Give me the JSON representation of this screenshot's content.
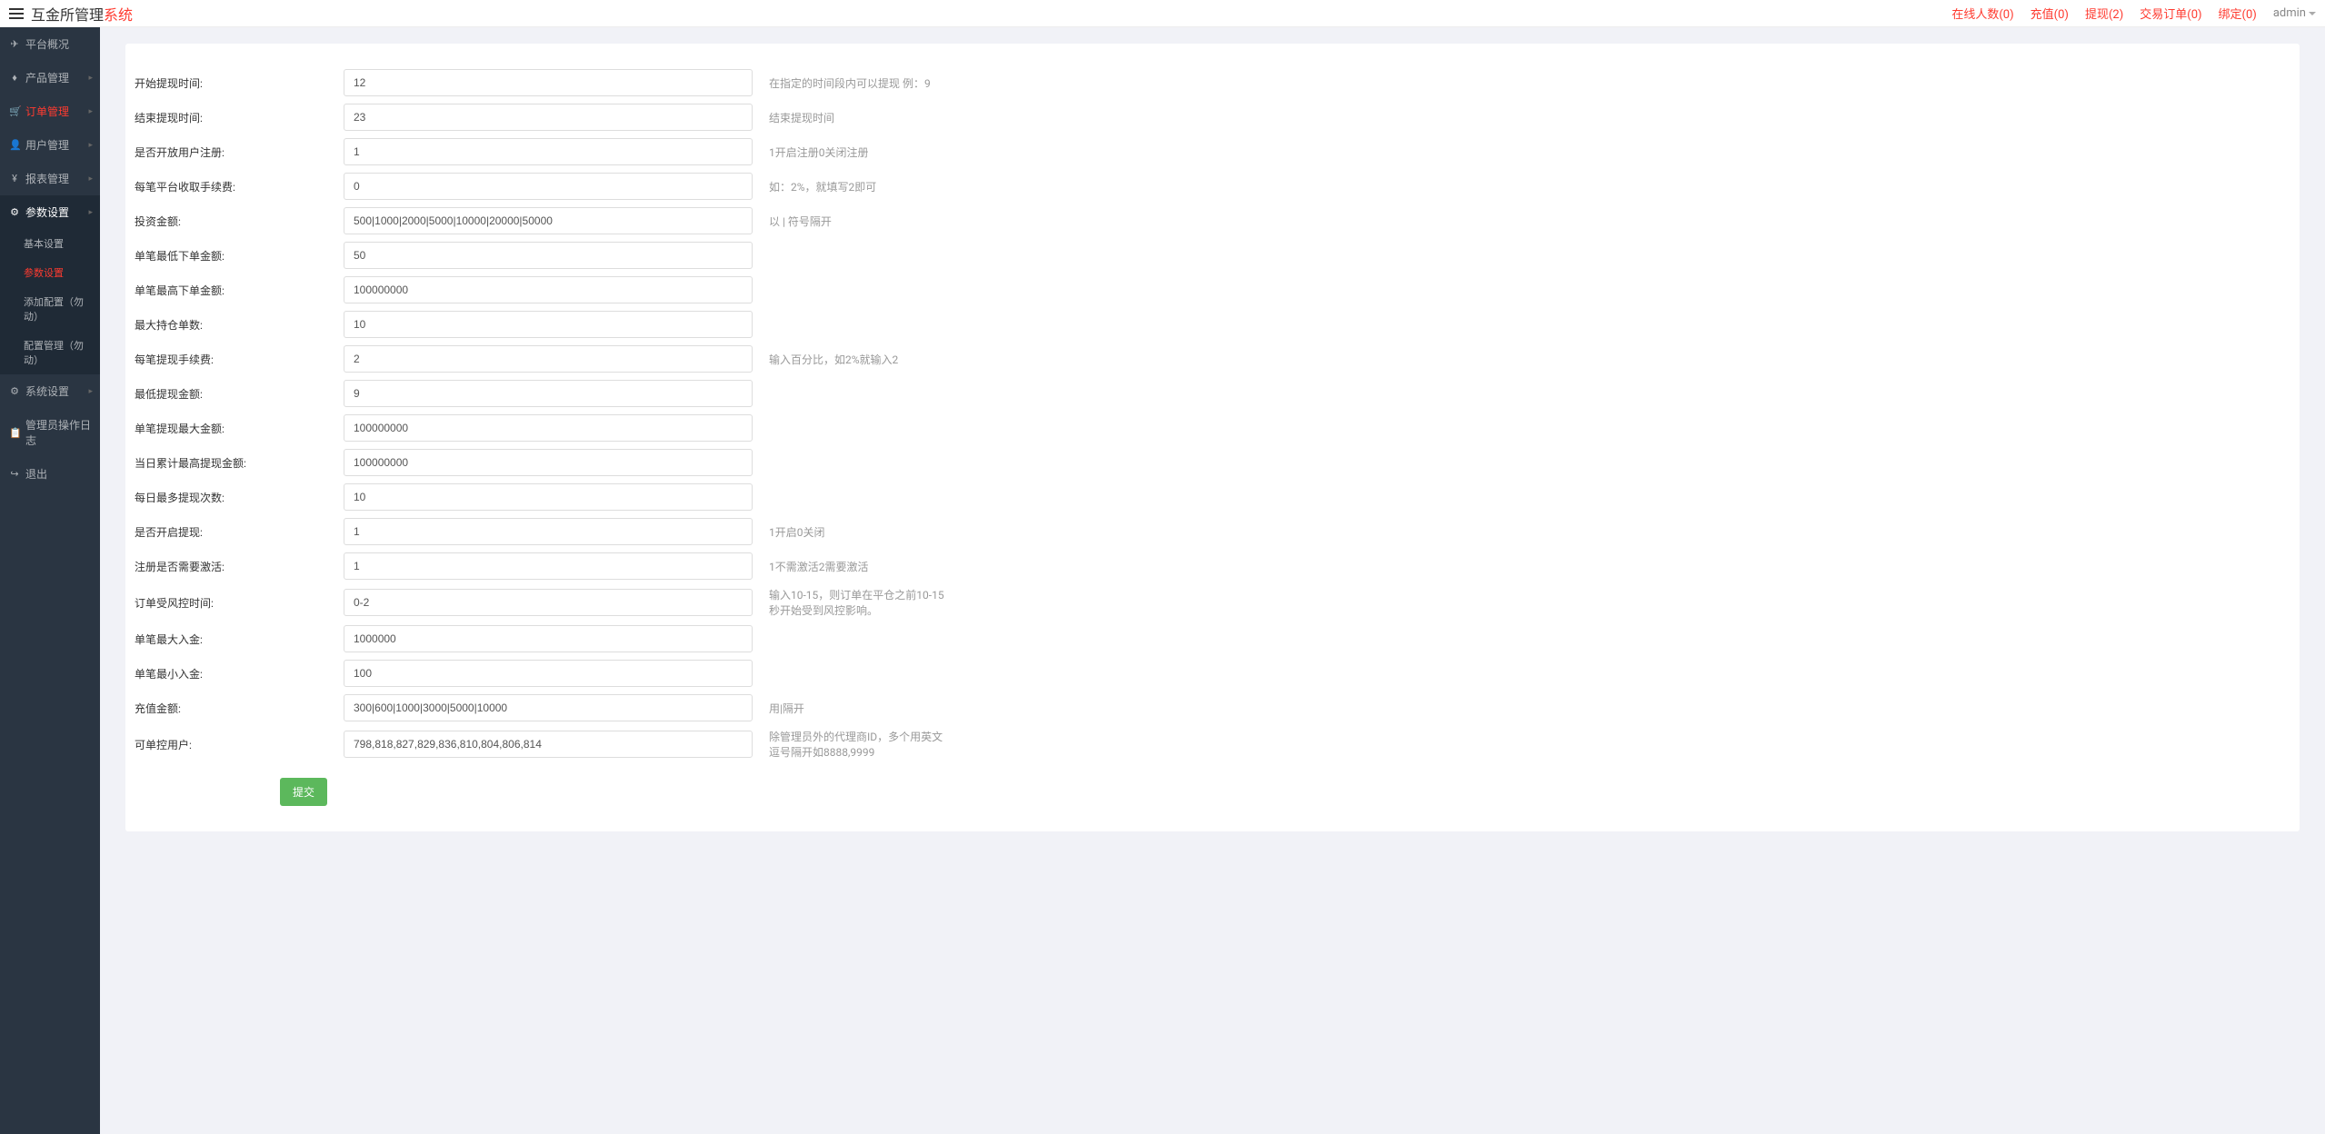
{
  "header": {
    "brand_main": "互金所管理",
    "brand_suffix": "系统",
    "links": {
      "online": "在线人数(0)",
      "recharge": "充值(0)",
      "withdraw": "提现(2)",
      "orders": "交易订单(0)",
      "bind": "绑定(0)",
      "admin": "admin"
    }
  },
  "sidebar": {
    "items": [
      {
        "icon": "✈",
        "label": "平台概况",
        "expandable": false
      },
      {
        "icon": "♦",
        "label": "产品管理",
        "expandable": true
      },
      {
        "icon": "🛒",
        "label": "订单管理",
        "expandable": true,
        "active": true
      },
      {
        "icon": "👤",
        "label": "用户管理",
        "expandable": true
      },
      {
        "icon": "¥",
        "label": "报表管理",
        "expandable": true
      },
      {
        "icon": "⚙",
        "label": "参数设置",
        "expandable": true,
        "open": true
      },
      {
        "icon": "⚙",
        "label": "系统设置",
        "expandable": true
      },
      {
        "icon": "📋",
        "label": "管理员操作日志",
        "expandable": false
      },
      {
        "icon": "↪",
        "label": "退出",
        "expandable": false
      }
    ],
    "sub_params": [
      {
        "label": "基本设置"
      },
      {
        "label": "参数设置",
        "active": true
      },
      {
        "label": "添加配置（勿动）"
      },
      {
        "label": "配置管理（勿动）"
      }
    ]
  },
  "form": {
    "rows": [
      {
        "label": "开始提现时间:",
        "value": "12",
        "hint": "在指定的时间段内可以提现 例：9"
      },
      {
        "label": "结束提现时间:",
        "value": "23",
        "hint": "结束提现时间"
      },
      {
        "label": "是否开放用户注册:",
        "value": "1",
        "hint": "1开启注册0关闭注册"
      },
      {
        "label": "每笔平台收取手续费:",
        "value": "0",
        "hint": "如：2%，就填写2即可"
      },
      {
        "label": "投资金额:",
        "value": "500|1000|2000|5000|10000|20000|50000",
        "hint": "以 | 符号隔开"
      },
      {
        "label": "单笔最低下单金额:",
        "value": "50",
        "hint": ""
      },
      {
        "label": "单笔最高下单金额:",
        "value": "100000000",
        "hint": ""
      },
      {
        "label": "最大持仓单数:",
        "value": "10",
        "hint": ""
      },
      {
        "label": "每笔提现手续费:",
        "value": "2",
        "hint": "输入百分比，如2%就输入2"
      },
      {
        "label": "最低提现金额:",
        "value": "9",
        "hint": ""
      },
      {
        "label": "单笔提现最大金额:",
        "value": "100000000",
        "hint": ""
      },
      {
        "label": "当日累计最高提现金额:",
        "value": "100000000",
        "hint": ""
      },
      {
        "label": "每日最多提现次数:",
        "value": "10",
        "hint": ""
      },
      {
        "label": "是否开启提现:",
        "value": "1",
        "hint": "1开启0关闭"
      },
      {
        "label": "注册是否需要激活:",
        "value": "1",
        "hint": "1不需激活2需要激活"
      },
      {
        "label": "订单受风控时间:",
        "value": "0-2",
        "hint": "输入10-15，则订单在平仓之前10-15秒开始受到风控影响。"
      },
      {
        "label": "单笔最大入金:",
        "value": "1000000",
        "hint": ""
      },
      {
        "label": "单笔最小入金:",
        "value": "100",
        "hint": ""
      },
      {
        "label": "充值金额:",
        "value": "300|600|1000|3000|5000|10000",
        "hint": "用|隔开"
      },
      {
        "label": "可单控用户:",
        "value": "798,818,827,829,836,810,804,806,814",
        "hint": "除管理员外的代理商ID，多个用英文逗号隔开如8888,9999"
      }
    ],
    "submit": "提交"
  }
}
